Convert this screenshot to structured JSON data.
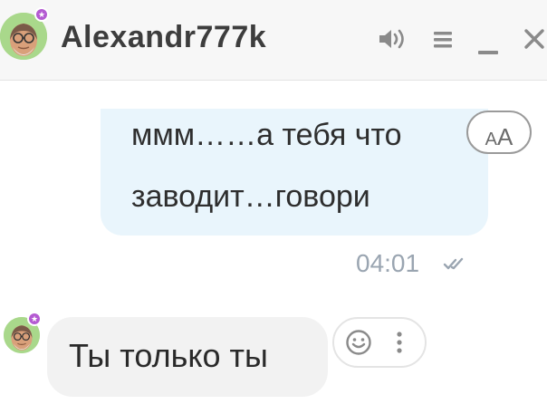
{
  "header": {
    "contact_name": "Alexandr777k",
    "online_badge": "★",
    "icons": {
      "speaker": "speaker-icon",
      "menu": "menu-icon",
      "minimize": "minimize-icon",
      "close": "close-icon"
    }
  },
  "messages": [
    {
      "direction": "outgoing",
      "lines": [
        "ммм……а тебя что",
        "заводит…говори"
      ],
      "time": "04:01",
      "status": "read"
    },
    {
      "direction": "incoming",
      "text": "Ты только ты"
    }
  ],
  "translate_button": {
    "small": "A",
    "big": "A"
  },
  "message_actions": {
    "icons": [
      "smiley-icon",
      "more-vertical-icon"
    ]
  },
  "colors": {
    "header_bg": "#f7f7f7",
    "outgoing_bubble": "#e9f5fc",
    "incoming_bubble": "#f2f2f2",
    "online_badge": "#b45ad2",
    "time_text": "#9aa5b1",
    "name_text": "#3d3d3d"
  }
}
